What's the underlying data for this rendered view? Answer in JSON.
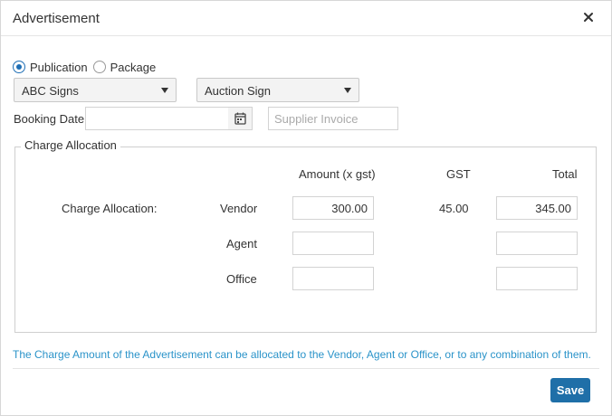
{
  "dialog": {
    "title": "Advertisement"
  },
  "type_options": {
    "publication_label": "Publication",
    "package_label": "Package",
    "selected": "Publication"
  },
  "selects": {
    "publication": "ABC Signs",
    "sign_type": "Auction Sign"
  },
  "booking": {
    "label": "Booking Date",
    "value": "",
    "supplier_placeholder": "Supplier Invoice"
  },
  "charge": {
    "legend": "Charge Allocation",
    "headers": {
      "amount": "Amount (x gst)",
      "gst": "GST",
      "total": "Total"
    },
    "row_label": "Charge Allocation:",
    "rows": [
      {
        "name": "Vendor",
        "amount": "300.00",
        "gst": "45.00",
        "total": "345.00"
      },
      {
        "name": "Agent",
        "amount": "",
        "gst": "",
        "total": ""
      },
      {
        "name": "Office",
        "amount": "",
        "gst": "",
        "total": ""
      }
    ]
  },
  "info_text": "The Charge Amount of the Advertisement can be allocated to the Vendor, Agent or Office, or to any combination of them.",
  "footer": {
    "save_label": "Save"
  },
  "colors": {
    "accent": "#1f6fa8",
    "info": "#2a93c9"
  }
}
